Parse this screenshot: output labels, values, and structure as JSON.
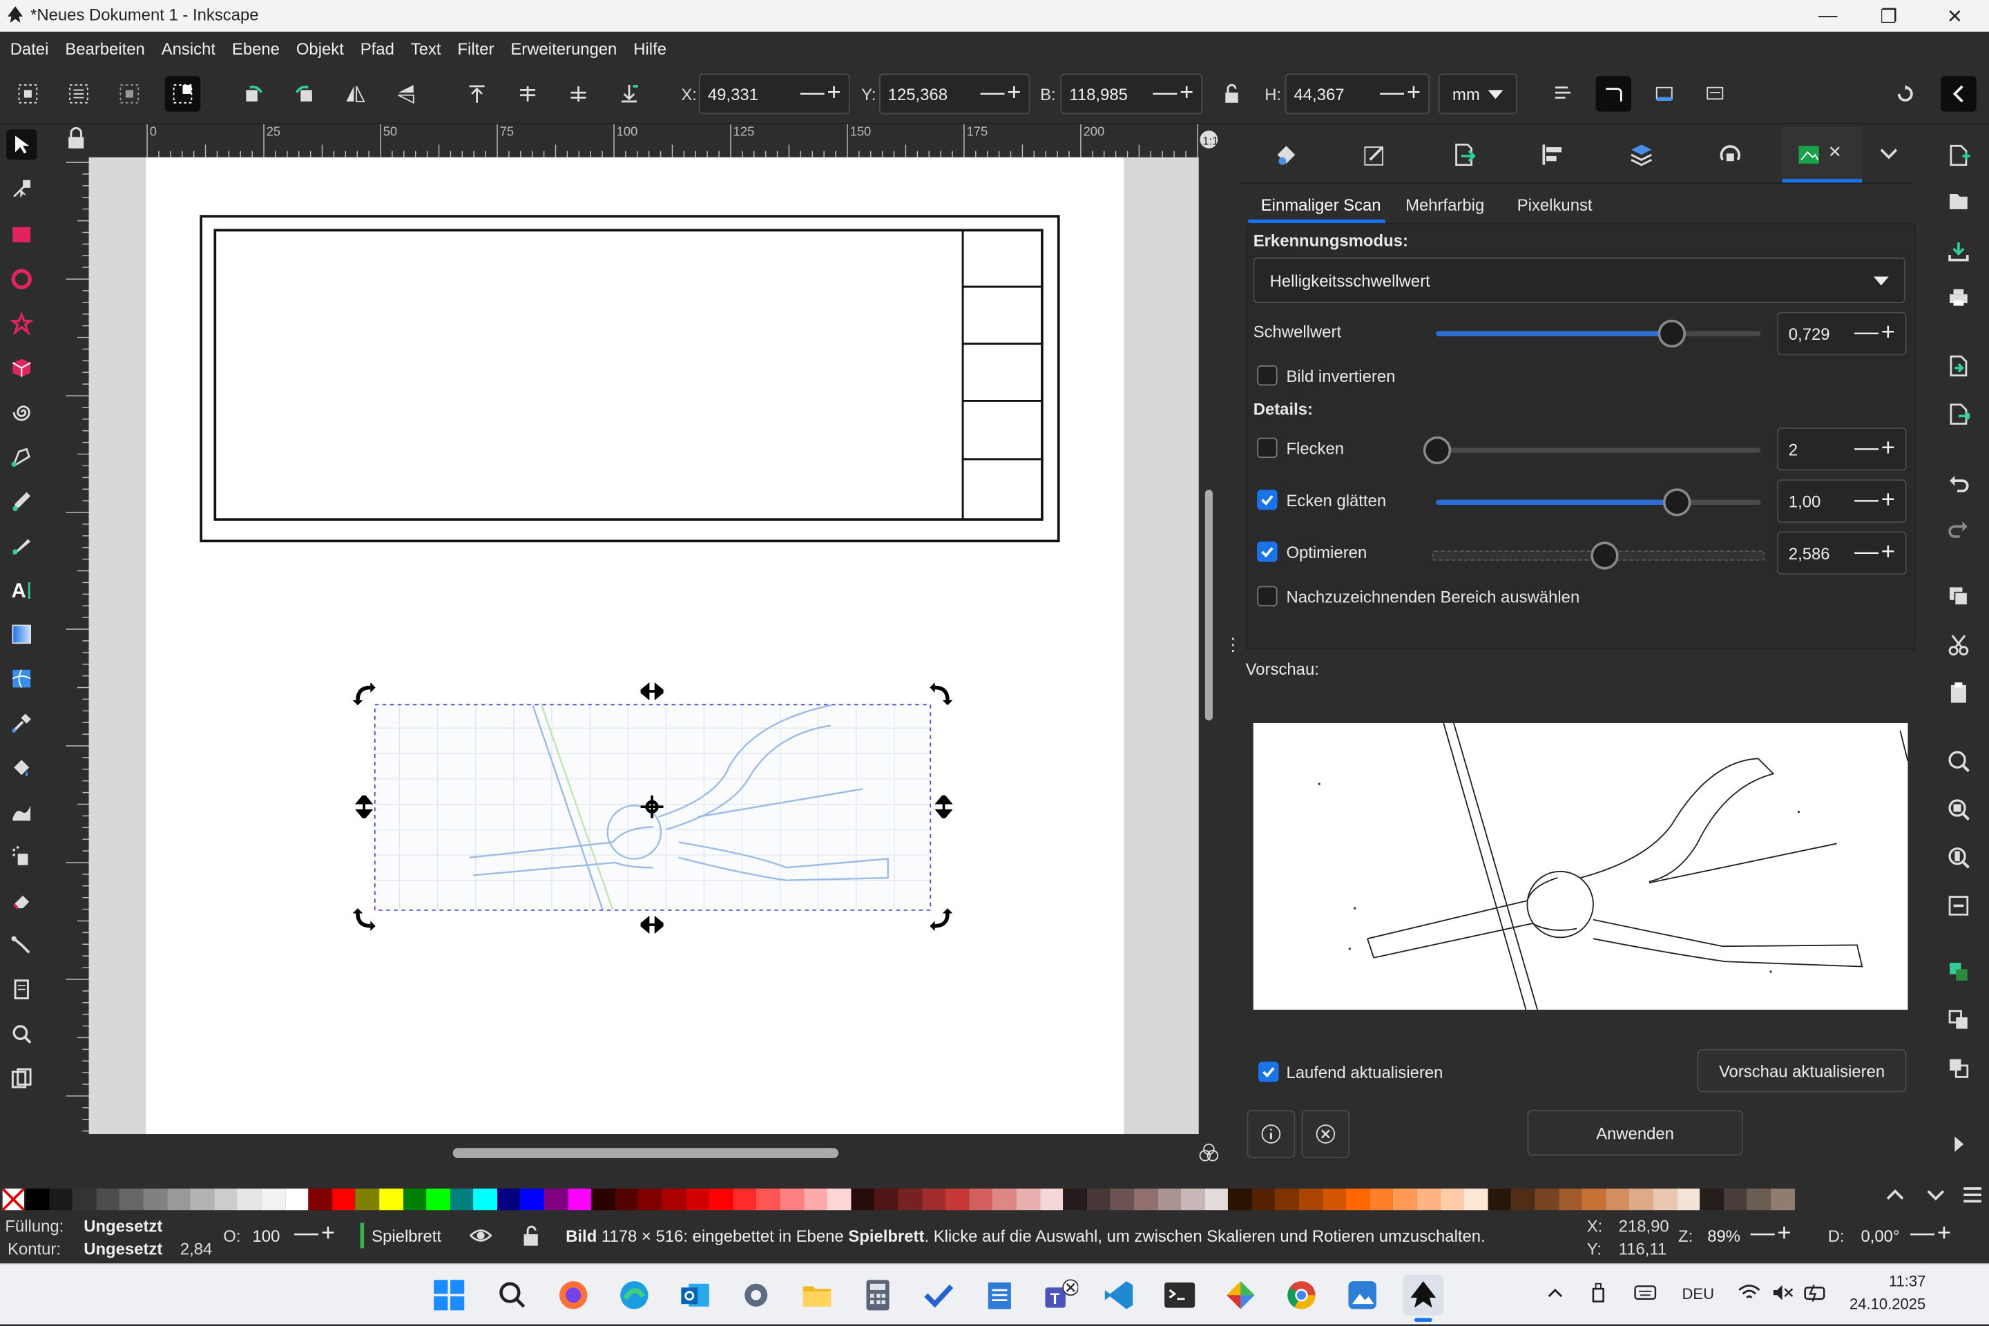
{
  "window": {
    "title": "*Neues Dokument 1 - Inkscape",
    "minimize": "—",
    "restore": "❐",
    "close": "✕"
  },
  "menu": [
    "Datei",
    "Bearbeiten",
    "Ansicht",
    "Ebene",
    "Objekt",
    "Pfad",
    "Text",
    "Filter",
    "Erweiterungen",
    "Hilfe"
  ],
  "toolbar": {
    "x_label": "X:",
    "x_value": "49,331",
    "y_label": "Y:",
    "y_value": "125,368",
    "w_label": "B:",
    "w_value": "118,985",
    "h_label": "H:",
    "h_value": "44,367",
    "unit": "mm",
    "plusminus": "—+"
  },
  "ruler": {
    "marks": [
      "0",
      "25",
      "50",
      "75",
      "100",
      "125",
      "150",
      "175",
      "200"
    ]
  },
  "vruler": {
    "marks": [
      "2",
      "5",
      "5",
      "0",
      "7",
      "5",
      "1",
      "0",
      "0",
      "1",
      "2",
      "5",
      "1",
      "5",
      "0",
      "1",
      "7",
      "5",
      "2",
      "0",
      "0"
    ]
  },
  "dock": {
    "tabs": [
      "Einmaliger Scan",
      "Mehrfarbig",
      "Pixelkunst"
    ],
    "mode_heading": "Erkennungsmodus:",
    "mode_value": "Helligkeitsschwellwert",
    "threshold_label": "Schwellwert",
    "threshold_value": "0,729",
    "threshold_level": 0.729,
    "invert_label": "Bild invertieren",
    "details_heading": "Details:",
    "speckles_label": "Flecken",
    "speckles_value": "2",
    "smooth_label": "Ecken glätten",
    "smooth_value": "1,00",
    "optimize_label": "Optimieren",
    "optimize_value": "2,586",
    "area_label": "Nachzuzeichnenden Bereich auswählen",
    "preview_heading": "Vorschau:",
    "live_label": "Laufend aktualisieren",
    "update_button": "Vorschau aktualisieren",
    "apply_button": "Anwenden",
    "close_tab": "✕"
  },
  "status": {
    "fill_label": "Füllung:",
    "fill_value": "Ungesetzt",
    "stroke_label": "Kontur:",
    "stroke_value": "Ungesetzt",
    "stroke_width": "2,84",
    "opacity_label": "O:",
    "opacity_value": "100",
    "layer_name": "Spielbrett",
    "message_bold": "Bild",
    "message_text": " 1178 × 516: eingebettet in Ebene ",
    "message_layer": "Spielbrett",
    "message_tail": ". Klicke auf die Auswahl, um zwischen Skalieren und Rotieren umzuschalten.",
    "cx_label": "X:",
    "cx": "218,90",
    "cy_label": "Y:",
    "cy": "116,11",
    "zoom_label": "Z:",
    "zoom": "89%",
    "rot_label": "D:",
    "rotation": "0,00°"
  },
  "taskbar": {
    "lang": "DEU",
    "time": "11:37",
    "date": "24.10.2025"
  },
  "palette_colors": [
    "#000000",
    "#1a1a1a",
    "#333333",
    "#4d4d4d",
    "#666666",
    "#808080",
    "#999999",
    "#b3b3b3",
    "#cccccc",
    "#e6e6e6",
    "#f2f2f2",
    "#ffffff",
    "#800000",
    "#ff0000",
    "#808000",
    "#ffff00",
    "#008000",
    "#00ff00",
    "#008080",
    "#00ffff",
    "#000080",
    "#0000ff",
    "#800080",
    "#ff00ff",
    "#2b0000",
    "#550000",
    "#800000",
    "#aa0000",
    "#d40000",
    "#ff0000",
    "#ff2a2a",
    "#ff5555",
    "#ff8080",
    "#ffaaaa",
    "#ffd5d5",
    "#280b0b",
    "#501616",
    "#782121",
    "#a02c2c",
    "#c83737",
    "#d35f5f",
    "#de8787",
    "#e9afaf",
    "#f4d7d7",
    "#241c1c",
    "#483737",
    "#6c5353",
    "#916f6f",
    "#ac9393",
    "#c8b7b7",
    "#e3dbdb",
    "#2b1100",
    "#552200",
    "#803300",
    "#aa4400",
    "#d45500",
    "#ff6600",
    "#ff7f2a",
    "#ff9955",
    "#ffb380",
    "#ffccaa",
    "#ffe6d5",
    "#28170b",
    "#502d16",
    "#784421",
    "#a05a2c",
    "#c87137",
    "#d38d5f",
    "#deaa87",
    "#e9c6af",
    "#f4e3d7",
    "#241f1c",
    "#483e37",
    "#6c5d53",
    "#917c6f"
  ]
}
